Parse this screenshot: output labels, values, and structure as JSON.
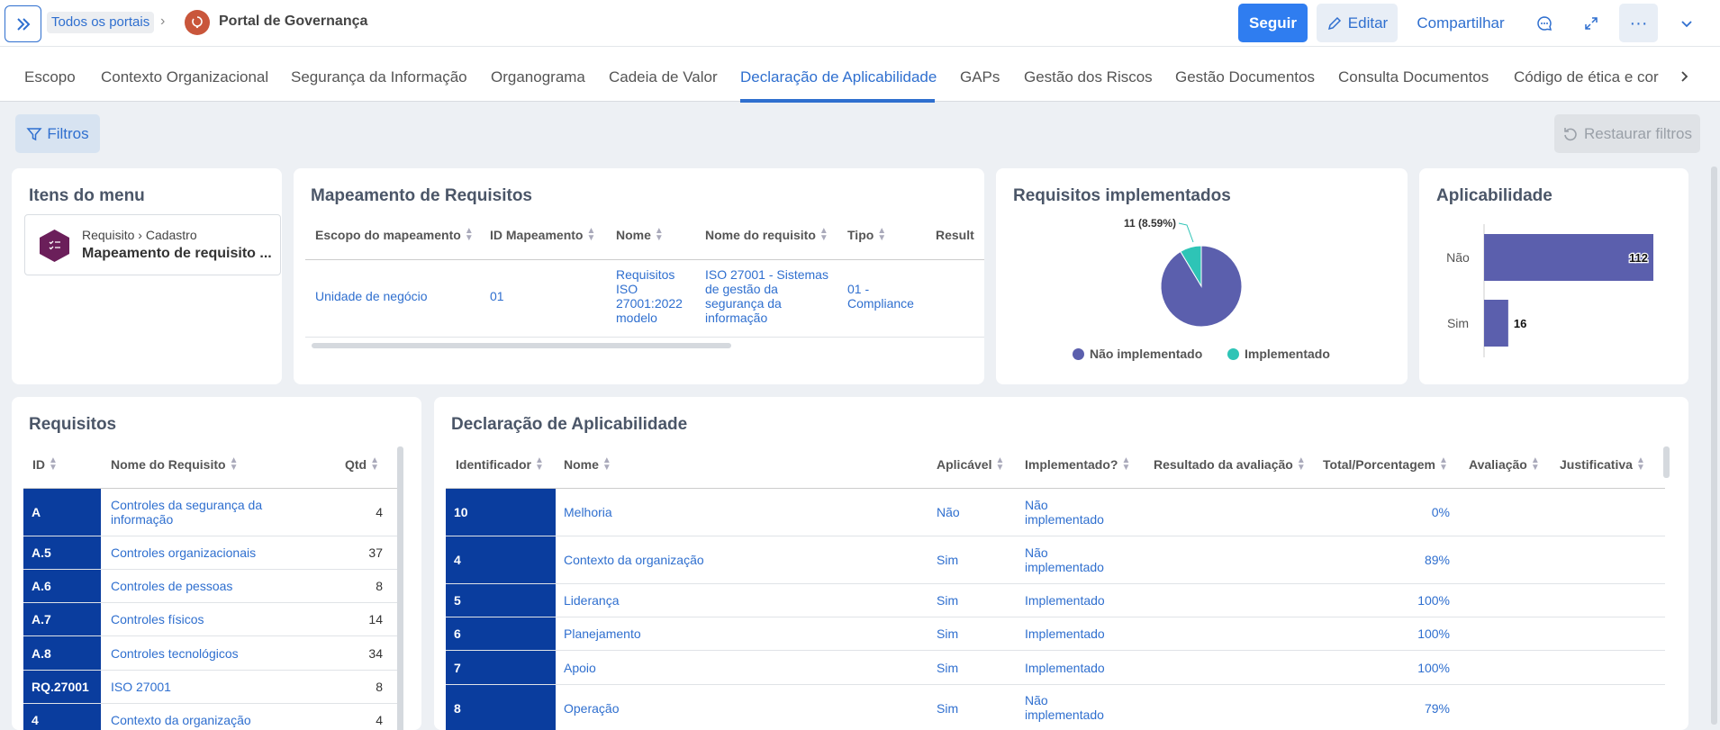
{
  "header": {
    "all_portals": "Todos os portais",
    "portal_name": "Portal de Governança",
    "follow_label": "Seguir",
    "edit_label": "Editar",
    "share_label": "Compartilhar"
  },
  "tabs": [
    {
      "label": "Escopo"
    },
    {
      "label": "Contexto Organizacional"
    },
    {
      "label": "Segurança da Informação"
    },
    {
      "label": "Organograma"
    },
    {
      "label": "Cadeia de Valor"
    },
    {
      "label": "Declaração de Aplicabilidade"
    },
    {
      "label": "GAPs"
    },
    {
      "label": "Gestão dos Riscos"
    },
    {
      "label": "Gestão Documentos"
    },
    {
      "label": "Consulta Documentos"
    },
    {
      "label": "Código de ética e cor"
    }
  ],
  "filters": {
    "filter_label": "Filtros",
    "restore_label": "Restaurar filtros"
  },
  "menu_card": {
    "title": "Itens do menu",
    "crumb_parent": "Requisito",
    "crumb_child": "Cadastro",
    "item_name": "Mapeamento de requisito ..."
  },
  "mapping_card": {
    "title": "Mapeamento de Requisitos",
    "columns": [
      "Escopo do mapeamento",
      "ID Mapeamento",
      "Nome",
      "Nome do requisito",
      "Tipo",
      "Result"
    ],
    "row": {
      "scope": "Unidade de negócio",
      "id": "01",
      "name": "Requisitos ISO 27001:2022 modelo",
      "req_name": "ISO 27001 - Sistemas de gestão da segurança da informação",
      "type": "01 - Compliance"
    }
  },
  "implemented_card": {
    "title": "Requisitos implementados",
    "slice_label": "11 (8.59%)",
    "legend": [
      "Não implementado",
      "Implementado"
    ]
  },
  "applicability_card": {
    "title": "Aplicabilidade"
  },
  "chart_data": [
    {
      "type": "pie",
      "title": "Requisitos implementados",
      "categories": [
        "Não implementado",
        "Implementado"
      ],
      "values": [
        117,
        11
      ],
      "colors": [
        "#5b5fad",
        "#2ec4b6"
      ],
      "annotations": [
        "11 (8.59%)"
      ],
      "legend_position": "bottom"
    },
    {
      "type": "bar",
      "orientation": "horizontal",
      "title": "Aplicabilidade",
      "categories": [
        "Não",
        "Sim"
      ],
      "values": [
        112,
        16
      ],
      "colors": [
        "#5b5fad",
        "#5b5fad"
      ],
      "xlim": [
        0,
        118
      ]
    }
  ],
  "requirements_card": {
    "title": "Requisitos",
    "columns": [
      "ID",
      "Nome do Requisito",
      "Qtd"
    ],
    "rows": [
      {
        "id": "A",
        "name": "Controles da segurança da informação",
        "qtd": "4"
      },
      {
        "id": "A.5",
        "name": "Controles organizacionais",
        "qtd": "37"
      },
      {
        "id": "A.6",
        "name": "Controles de pessoas",
        "qtd": "8"
      },
      {
        "id": "A.7",
        "name": "Controles físicos",
        "qtd": "14"
      },
      {
        "id": "A.8",
        "name": "Controles tecnológicos",
        "qtd": "34"
      },
      {
        "id": "RQ.27001",
        "name": "ISO 27001",
        "qtd": "8"
      },
      {
        "id": "4",
        "name": "Contexto da organização",
        "qtd": "4"
      }
    ]
  },
  "declaration_card": {
    "title": "Declaração de Aplicabilidade",
    "columns": [
      "Identificador",
      "Nome",
      "Aplicável",
      "Implementado?",
      "Resultado da avaliação",
      "Total/Porcentagem",
      "Avaliação",
      "Justificativa"
    ],
    "rows": [
      {
        "id": "10",
        "name": "Melhoria",
        "applicable": "Não",
        "implemented": "Não implementado",
        "total": "0%"
      },
      {
        "id": "4",
        "name": "Contexto da organização",
        "applicable": "Sim",
        "implemented": "Não implementado",
        "total": "89%"
      },
      {
        "id": "5",
        "name": "Liderança",
        "applicable": "Sim",
        "implemented": "Implementado",
        "total": "100%"
      },
      {
        "id": "6",
        "name": "Planejamento",
        "applicable": "Sim",
        "implemented": "Implementado",
        "total": "100%"
      },
      {
        "id": "7",
        "name": "Apoio",
        "applicable": "Sim",
        "implemented": "Implementado",
        "total": "100%"
      },
      {
        "id": "8",
        "name": "Operação",
        "applicable": "Sim",
        "implemented": "Não implementado",
        "total": "79%"
      }
    ]
  }
}
